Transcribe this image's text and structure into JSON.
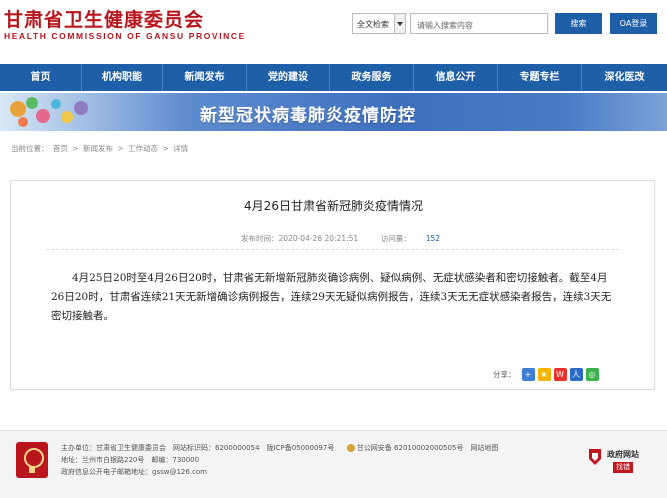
{
  "header": {
    "title": "甘肃省卫生健康委员会",
    "subtitle": "HEALTH COMMISSION OF GANSU PROVINCE",
    "search_scope": "全文检索",
    "search_placeholder": "请输入搜索内容",
    "search_button": "搜索",
    "oa_button": "OA登录"
  },
  "nav": {
    "items": [
      "首页",
      "机构职能",
      "新闻发布",
      "党的建设",
      "政务服务",
      "信息公开",
      "专题专栏",
      "深化医改"
    ]
  },
  "banner": {
    "text": "新型冠状病毒肺炎疫情防控"
  },
  "breadcrumb": {
    "prefix": "当前位置：",
    "items": [
      "首页",
      "新闻发布",
      "工作动态",
      "详情"
    ],
    "separator": ">"
  },
  "article": {
    "title": "4月26日甘肃省新冠肺炎疫情情况",
    "published_label": "发布时间：",
    "published": "2020-04-26 20:21:51",
    "views_label": "访问量：",
    "views": "152",
    "body": "4月25日20时至4月26日20时，甘肃省无新增新冠肺炎确诊病例、疑似病例、无症状感染者和密切接触者。截至4月26日20时，甘肃省连续21天无新增确诊病例报告，连续29天无疑似病例报告，连续3天无无症状感染者报告，连续3天无密切接触者。",
    "share_label": "分享："
  },
  "footer": {
    "line1": "主办单位：甘肃省卫生健康委员会　网站标识码：6200000054　陇ICP备05000097号",
    "police_text": "甘公网安备 62010002000505号　网站地图",
    "line2": "地址：兰州市白银路220号　邮编：730000",
    "line3": "政府信息公开电子邮箱地址：gssw@126.com",
    "gov_badge_title": "政府网站",
    "gov_badge_sub": "找错"
  },
  "colors": {
    "brand_red": "#b8161c",
    "nav_blue": "#1f5fa8"
  }
}
